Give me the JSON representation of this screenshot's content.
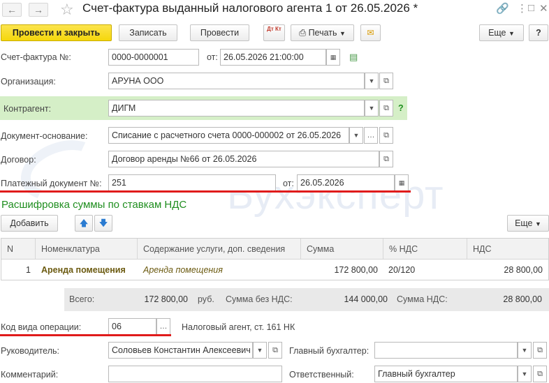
{
  "window": {
    "title": "Счет-фактура выданный налогового агента 1 от 26.05.2026 *",
    "back_icon": "arrow-left-icon",
    "forward_icon": "arrow-right-icon",
    "star_icon": "star-icon",
    "link_icon": "link-icon",
    "menu_icon": "more-vertical-icon",
    "maximize_icon": "maximize-icon",
    "close_icon": "close-icon"
  },
  "toolbar": {
    "post_and_close": "Провести и закрыть",
    "save": "Записать",
    "post": "Провести",
    "dt_kt_label": "Дт Кт",
    "print": "Печать",
    "more": "Еще",
    "help": "?"
  },
  "form": {
    "invoice_label": "Счет-фактура №:",
    "invoice_number": "0000-0000001",
    "date_label": "от:",
    "invoice_date": "26.05.2026 21:00:00",
    "organization_label": "Организация:",
    "organization": "АРУНА ООО",
    "counterparty_label": "Контрагент:",
    "counterparty": "ДИГМ",
    "base_doc_label": "Документ-основание:",
    "base_doc": "Списание с расчетного счета 0000-000002 от 26.05.2026",
    "contract_label": "Договор:",
    "contract": "Договор аренды №66 от 26.05.2026",
    "payment_doc_label": "Платежный документ №:",
    "payment_doc": "251",
    "payment_date_label": "от:",
    "payment_date": "26.05.2026"
  },
  "vat_section": {
    "title": "Расшифровка суммы по ставкам НДС",
    "add": "Добавить",
    "more": "Еще",
    "columns": [
      "N",
      "Номенклатура",
      "Содержание услуги, доп. сведения",
      "Сумма",
      "% НДС",
      "НДС"
    ],
    "rows": [
      {
        "n": "1",
        "item": "Аренда помещения",
        "content": "Аренда помещения",
        "sum": "172 800,00",
        "rate": "20/120",
        "vat": "28 800,00"
      }
    ]
  },
  "totals": {
    "total_label": "Всего:",
    "total": "172 800,00",
    "currency": "руб.",
    "without_vat_label": "Сумма без НДС:",
    "without_vat": "144 000,00",
    "vat_label": "Сумма НДС:",
    "vat": "28 800,00"
  },
  "footer": {
    "operation_code_label": "Код вида операции:",
    "operation_code": "06",
    "operation_desc": "Налоговый агент, ст. 161 НК",
    "head_label": "Руководитель:",
    "head": "Соловьев Константин Алексеевич",
    "chief_accountant_label": "Главный бухгалтер:",
    "chief_accountant": "",
    "comment_label": "Комментарий:",
    "comment": "",
    "responsible_label": "Ответственный:",
    "responsible": "Главный бухгалтер"
  },
  "watermark": "Бухэксперт",
  "colors": {
    "primary_button": "#f5d70b",
    "section_title": "#1f8e1f",
    "highlight_band": "#d5efc7",
    "annotation_line": "#e01b1b"
  }
}
